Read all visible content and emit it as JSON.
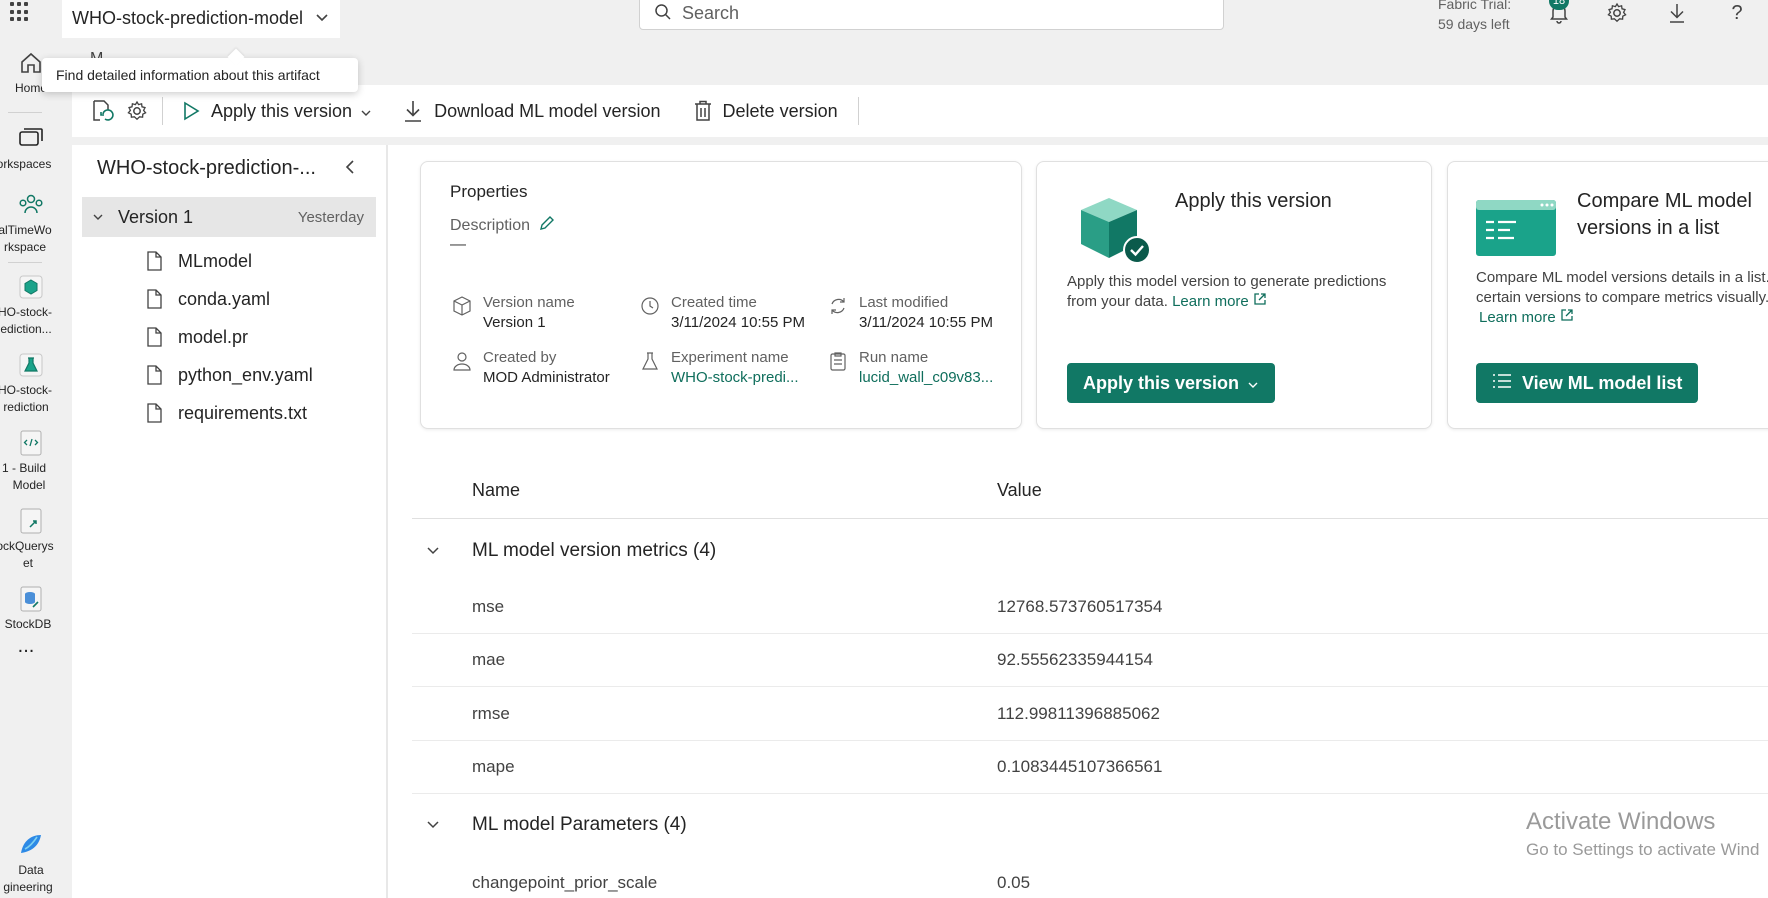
{
  "topbar": {
    "artifact_name": "WHO-stock-prediction-model",
    "search_placeholder": "Search",
    "trial_line1": "Fabric Trial:",
    "trial_line2": "59 days left",
    "notification_count": "18"
  },
  "tooltip": {
    "text": "Find detailed information about this artifact",
    "behind_text": "M"
  },
  "rail": {
    "items": [
      {
        "label_lines": [
          "Home"
        ],
        "icon": "home-icon"
      },
      {
        "label_lines": [
          "orkspaces"
        ],
        "icon": "workspaces-icon"
      },
      {
        "label_lines": [
          "alTimeWo",
          "rkspace"
        ],
        "icon": "workspace-people-icon"
      },
      {
        "label_lines": [
          "HO-stock-",
          "ediction..."
        ],
        "icon": "ml-model-icon"
      },
      {
        "label_lines": [
          "HO-stock-",
          "rediction"
        ],
        "icon": "experiment-icon"
      },
      {
        "label_lines": [
          "1 - Build",
          "Model"
        ],
        "icon": "notebook-icon"
      },
      {
        "label_lines": [
          "ockQuerys",
          "et"
        ],
        "icon": "queryset-icon"
      },
      {
        "label_lines": [
          "StockDB"
        ],
        "icon": "database-icon"
      },
      {
        "label_lines": [
          "..."
        ],
        "icon": "more-icon"
      },
      {
        "label_lines": [
          "Data",
          "gineering"
        ],
        "icon": "data-engineering-icon"
      }
    ]
  },
  "toolbar": {
    "apply_label": "Apply this version",
    "download_label": "Download ML model version",
    "delete_label": "Delete version"
  },
  "left_pane": {
    "title": "WHO-stock-prediction-...",
    "version_label": "Version 1",
    "version_date": "Yesterday",
    "files": [
      "MLmodel",
      "conda.yaml",
      "model.pr",
      "python_env.yaml",
      "requirements.txt"
    ]
  },
  "properties": {
    "title": "Properties",
    "description_label": "Description",
    "description_value": "—",
    "version_name_label": "Version name",
    "version_name_value": "Version 1",
    "created_time_label": "Created time",
    "created_time_value": "3/11/2024 10:55 PM",
    "last_modified_label": "Last modified",
    "last_modified_value": "3/11/2024 10:55 PM",
    "created_by_label": "Created by",
    "created_by_value": "MOD Administrator",
    "experiment_label": "Experiment name",
    "experiment_value": "WHO-stock-predi...",
    "run_label": "Run name",
    "run_value": "lucid_wall_c09v83..."
  },
  "apply_card": {
    "title": "Apply this version",
    "text": "Apply this model version to generate predictions from your data.",
    "learn_more": "Learn more",
    "button": "Apply this version"
  },
  "compare_card": {
    "title_line1": "Compare ML model",
    "title_line2": "versions in a list",
    "text_line1": "Compare ML model versions details in a list.",
    "text_line2": "certain versions to compare metrics visually.",
    "learn_more": "Learn more",
    "button": "View ML model list"
  },
  "table": {
    "col_name": "Name",
    "col_value": "Value",
    "metrics_group": "ML model version metrics (4)",
    "metrics": [
      {
        "name": "mse",
        "value": "12768.573760517354"
      },
      {
        "name": "mae",
        "value": "92.55562335944154"
      },
      {
        "name": "rmse",
        "value": "112.99811396885062"
      },
      {
        "name": "mape",
        "value": "0.1083445107366561"
      }
    ],
    "params_group": "ML model Parameters (4)",
    "params": [
      {
        "name": "changepoint_prior_scale",
        "value": "0.05"
      }
    ]
  },
  "watermark": {
    "line1": "Activate Windows",
    "line2": "Go to Settings to activate Wind"
  },
  "colors": {
    "accent": "#117865",
    "link": "#0f6e5c"
  }
}
